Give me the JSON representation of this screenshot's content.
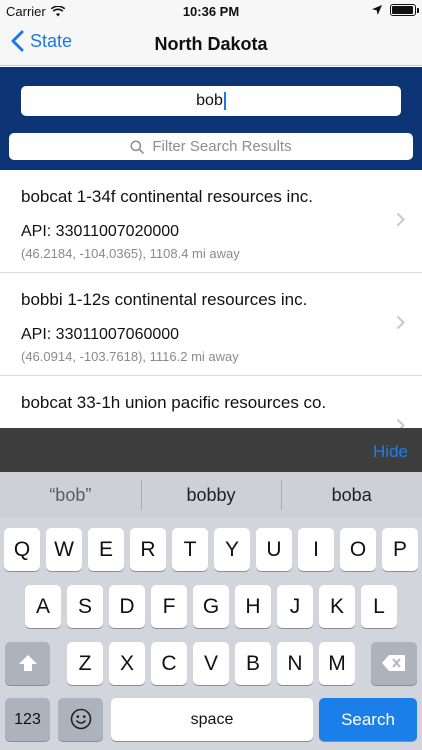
{
  "status_bar": {
    "carrier": "Carrier",
    "time": "10:36 PM"
  },
  "nav": {
    "back_label": "State",
    "title": "North Dakota"
  },
  "search": {
    "query": "bob",
    "filter_placeholder": "Filter Search Results"
  },
  "results": [
    {
      "title": "bobcat 1-34f continental resources inc.",
      "api": "API: 33011007020000",
      "location": "(46.2184, -104.0365), 1108.4 mi away"
    },
    {
      "title": "bobbi 1-12s continental resources inc.",
      "api": "API: 33011007060000",
      "location": "(46.0914, -103.7618), 1116.2 mi away"
    },
    {
      "title": "bobcat 33-1h union pacific resources co.",
      "api": "",
      "location": ""
    }
  ],
  "keyboard": {
    "accessory_hide": "Hide",
    "suggestions": [
      "“bob”",
      "bobby",
      "boba"
    ],
    "row1": [
      "Q",
      "W",
      "E",
      "R",
      "T",
      "Y",
      "U",
      "I",
      "O",
      "P"
    ],
    "row2": [
      "A",
      "S",
      "D",
      "F",
      "G",
      "H",
      "J",
      "K",
      "L"
    ],
    "row3": [
      "Z",
      "X",
      "C",
      "V",
      "B",
      "N",
      "M"
    ],
    "numbers_label": "123",
    "space_label": "space",
    "search_label": "Search"
  },
  "colors": {
    "accent": "#1b78e6",
    "header_bg": "#0d3474",
    "keyboard_bg": "#d2d5db"
  },
  "icons": {
    "wifi": "wifi-icon",
    "location": "location-arrow-icon",
    "battery": "battery-icon",
    "back": "chevron-left-icon",
    "search": "search-icon",
    "disclosure": "chevron-right-icon",
    "shift": "shift-icon",
    "delete": "delete-icon",
    "emoji": "emoji-icon"
  }
}
